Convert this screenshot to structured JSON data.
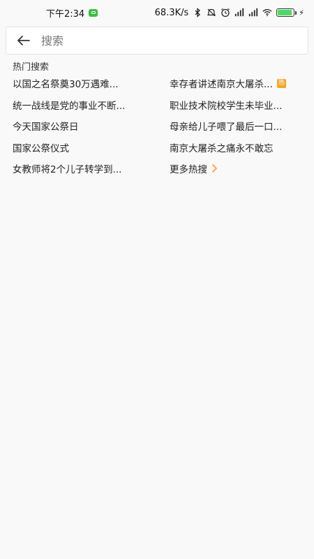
{
  "status_bar": {
    "time": "下午2:34",
    "net_speed": "68.3K/s",
    "battery_level": 0.9,
    "accent_wechat": "#35c13c"
  },
  "search": {
    "placeholder": "搜索",
    "back_icon": "arrow-left-icon"
  },
  "hot": {
    "title": "热门搜索",
    "badge": "热",
    "badge_color": "#f5a623",
    "items": [
      "以国之名祭奠30万遇难...",
      "幸存者讲述南京大屠杀...",
      "统一战线是党的事业不断...",
      "职业技术院校学生未毕业...",
      "今天国家公祭日",
      "母亲给儿子喂了最后一口...",
      "国家公祭仪式",
      "南京大屠杀之痛永不敢忘",
      "女教师将2个儿子转学到..."
    ],
    "more_label": "更多热搜",
    "more_arrow_color": "#f5a623"
  }
}
